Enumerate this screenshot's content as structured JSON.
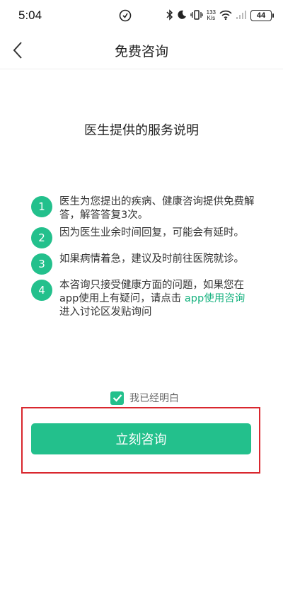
{
  "status_bar": {
    "time": "5:04",
    "net_speed_value": "133",
    "net_speed_unit": "K/s",
    "battery": "44"
  },
  "navbar": {
    "title": "免费咨询"
  },
  "main": {
    "title": "医生提供的服务说明",
    "notes": [
      {
        "num": "1",
        "text": "医生为您提出的疾病、健康咨询提供免费解答，解答答复3次。"
      },
      {
        "num": "2",
        "text": "因为医生业余时间回复，可能会有延时。"
      },
      {
        "num": "3",
        "text": "如果病情着急，建议及时前往医院就诊。"
      },
      {
        "num": "4",
        "text_before": "本咨询只接受健康方面的问题，如果您在app使用上有疑问，请点击 ",
        "link": "app使用咨询",
        "text_after": " 进入讨论区发贴询问"
      }
    ]
  },
  "agreement": {
    "label": "我已经明白",
    "checked": true
  },
  "button": {
    "label": "立刻咨询"
  },
  "colors": {
    "accent": "#23c08c",
    "highlight": "#d9272e"
  }
}
